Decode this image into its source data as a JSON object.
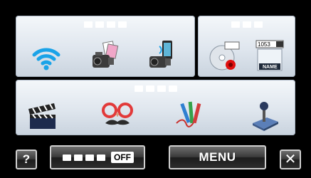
{
  "panels": {
    "top_left": {
      "title_blocks": 4
    },
    "top_right": {
      "title_blocks": 3
    },
    "bottom": {
      "title_blocks": 4
    }
  },
  "icons": {
    "wifi": "wifi-icon",
    "camera_to_phone": "camera-to-phone-icon",
    "camera_with_phone": "camera-with-phone-icon",
    "disc_record": "disc-record-icon",
    "name_label": "name-label-icon",
    "clapperboard": "clapperboard-icon",
    "funny_glasses": "funny-glasses-icon",
    "pencils": "pencils-icon",
    "joystick": "joystick-icon"
  },
  "name_tile": {
    "header_text": "1053",
    "caption": "NAME"
  },
  "buttons": {
    "help_label": "?",
    "toggle_state": "OFF",
    "menu_label": "MENU",
    "close_label": "✕"
  },
  "colors": {
    "wifi": "#1aa3e8",
    "record_red": "#e01010",
    "glasses_red": "#e23a3a"
  }
}
